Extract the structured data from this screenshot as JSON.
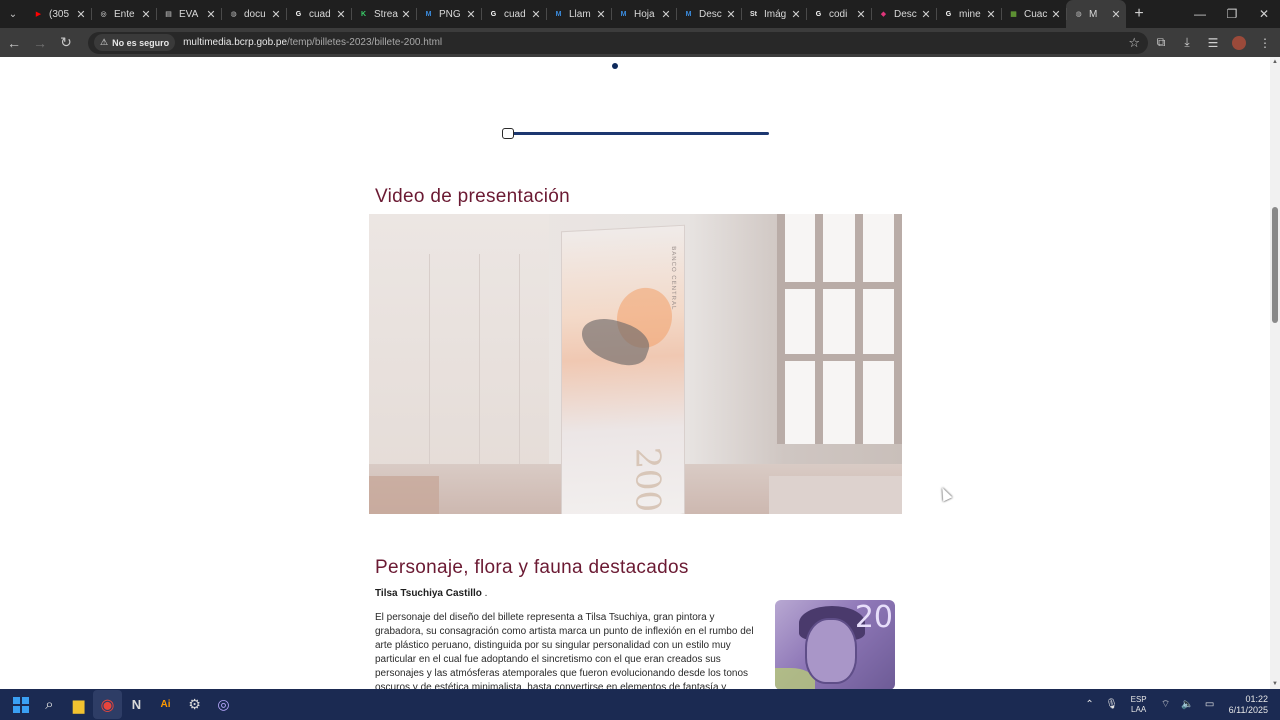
{
  "browser": {
    "tabs": [
      {
        "title": "(305",
        "favicon": "youtube-icon",
        "color": "#ff0000",
        "glyph": "▶"
      },
      {
        "title": "Ente",
        "favicon": "circle-icon",
        "color": "#e8e8e8",
        "glyph": "◎"
      },
      {
        "title": "EVA",
        "favicon": "document-icon",
        "color": "#d9d9d9",
        "glyph": "▤"
      },
      {
        "title": "docu",
        "favicon": "globe-icon",
        "color": "#bdbdbd",
        "glyph": "◍"
      },
      {
        "title": "cuad",
        "favicon": "google-icon",
        "color": "#ffffff",
        "glyph": "G"
      },
      {
        "title": "Strea",
        "favicon": "k-icon",
        "color": "#3ad16a",
        "glyph": "K"
      },
      {
        "title": "PNG",
        "favicon": "m-icon",
        "color": "#3b8de0",
        "glyph": "M"
      },
      {
        "title": "cuad",
        "favicon": "google-icon",
        "color": "#ffffff",
        "glyph": "G"
      },
      {
        "title": "Llam",
        "favicon": "m-icon",
        "color": "#3b8de0",
        "glyph": "M"
      },
      {
        "title": "Hoja",
        "favicon": "m-icon",
        "color": "#3b8de0",
        "glyph": "M"
      },
      {
        "title": "Desc",
        "favicon": "m-icon",
        "color": "#3b8de0",
        "glyph": "M"
      },
      {
        "title": "Imág",
        "favicon": "st-icon",
        "color": "#e8e8e8",
        "glyph": "St"
      },
      {
        "title": "codi",
        "favicon": "google-icon",
        "color": "#ffffff",
        "glyph": "G"
      },
      {
        "title": "Desc",
        "favicon": "pink-icon",
        "color": "#e0357a",
        "glyph": "◆"
      },
      {
        "title": "mine",
        "favicon": "google-icon",
        "color": "#ffffff",
        "glyph": "G"
      },
      {
        "title": "Cuac",
        "favicon": "sheet-icon",
        "color": "#7fcf3f",
        "glyph": "▦"
      },
      {
        "title": "M",
        "favicon": "globe-icon",
        "color": "#bdbdbd",
        "glyph": "◍",
        "active": true
      }
    ],
    "security_label": "No es seguro",
    "url_host": "multimedia.bcrp.gob.pe",
    "url_path": "/temp/billetes-2023/billete-200.html"
  },
  "page": {
    "video_section_title": "Video de presentación",
    "banknote_denomination": "200",
    "banknote_legend": "BANCO CENTRAL",
    "featured_section_title": "Personaje, flora y fauna destacados",
    "person_name": "Tilsa Tsuchiya Castillo",
    "person_name_suffix": " .",
    "person_text": "El personaje del diseño del billete representa a Tilsa Tsuchiya, gran pintora y grabadora, su consagración como artista marca un punto de inflexión en el rumbo del arte plástico peruano, distinguida por su singular personalidad con un estilo muy particular en el cual fue adoptando el sincretismo con el que eran creados sus personajes y las atmósferas atemporales que fueron evolucionando desde los tonos oscuros y de estética minimalista, hasta convertirse en elementos de fantasía y",
    "photo_number": "20",
    "accent_color": "#6b1a33",
    "slider_color": "#1c3770"
  },
  "taskbar": {
    "lang_line1": "ESP",
    "lang_line2": "LAA",
    "time": "01:22",
    "date": "6/11/2025"
  }
}
